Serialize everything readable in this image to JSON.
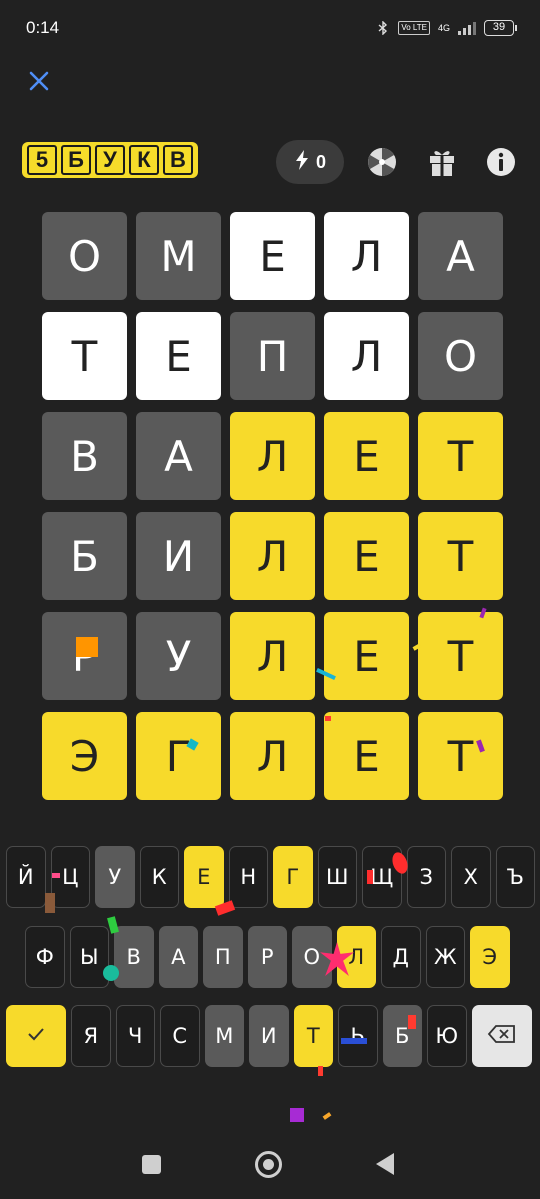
{
  "status": {
    "time": "0:14",
    "network": "4G",
    "volte": "Vo LTE",
    "battery": "39"
  },
  "logo": {
    "letters": [
      "5",
      "Б",
      "У",
      "К",
      "В"
    ]
  },
  "energy": {
    "count": "0"
  },
  "board": {
    "rows": [
      [
        {
          "l": "О",
          "s": "gray"
        },
        {
          "l": "М",
          "s": "gray"
        },
        {
          "l": "Е",
          "s": "white"
        },
        {
          "l": "Л",
          "s": "white"
        },
        {
          "l": "А",
          "s": "gray"
        }
      ],
      [
        {
          "l": "Т",
          "s": "white"
        },
        {
          "l": "Е",
          "s": "white"
        },
        {
          "l": "П",
          "s": "gray"
        },
        {
          "l": "Л",
          "s": "white"
        },
        {
          "l": "О",
          "s": "gray"
        }
      ],
      [
        {
          "l": "В",
          "s": "gray"
        },
        {
          "l": "А",
          "s": "gray"
        },
        {
          "l": "Л",
          "s": "yellow"
        },
        {
          "l": "Е",
          "s": "yellow"
        },
        {
          "l": "Т",
          "s": "yellow"
        }
      ],
      [
        {
          "l": "Б",
          "s": "gray"
        },
        {
          "l": "И",
          "s": "gray"
        },
        {
          "l": "Л",
          "s": "yellow"
        },
        {
          "l": "Е",
          "s": "yellow"
        },
        {
          "l": "Т",
          "s": "yellow"
        }
      ],
      [
        {
          "l": "Р",
          "s": "gray"
        },
        {
          "l": "У",
          "s": "gray"
        },
        {
          "l": "Л",
          "s": "yellow"
        },
        {
          "l": "Е",
          "s": "yellow"
        },
        {
          "l": "Т",
          "s": "yellow"
        }
      ],
      [
        {
          "l": "Э",
          "s": "yellow"
        },
        {
          "l": "Г",
          "s": "yellow"
        },
        {
          "l": "Л",
          "s": "yellow"
        },
        {
          "l": "Е",
          "s": "yellow"
        },
        {
          "l": "Т",
          "s": "yellow"
        }
      ]
    ]
  },
  "keyboard": {
    "row1": [
      {
        "l": "Й",
        "s": "none"
      },
      {
        "l": "Ц",
        "s": "none"
      },
      {
        "l": "У",
        "s": "gray"
      },
      {
        "l": "К",
        "s": "none"
      },
      {
        "l": "Е",
        "s": "yellow"
      },
      {
        "l": "Н",
        "s": "none"
      },
      {
        "l": "Г",
        "s": "yellow"
      },
      {
        "l": "Ш",
        "s": "none"
      },
      {
        "l": "Щ",
        "s": "none"
      },
      {
        "l": "З",
        "s": "none"
      },
      {
        "l": "Х",
        "s": "none"
      },
      {
        "l": "Ъ",
        "s": "none"
      }
    ],
    "row2": [
      {
        "l": "Ф",
        "s": "none"
      },
      {
        "l": "Ы",
        "s": "none"
      },
      {
        "l": "В",
        "s": "gray"
      },
      {
        "l": "А",
        "s": "gray"
      },
      {
        "l": "П",
        "s": "gray"
      },
      {
        "l": "Р",
        "s": "gray"
      },
      {
        "l": "О",
        "s": "gray"
      },
      {
        "l": "Л",
        "s": "yellow"
      },
      {
        "l": "Д",
        "s": "none"
      },
      {
        "l": "Ж",
        "s": "none"
      },
      {
        "l": "Э",
        "s": "yellow"
      }
    ],
    "row3": [
      {
        "l": "Я",
        "s": "none"
      },
      {
        "l": "Ч",
        "s": "none"
      },
      {
        "l": "С",
        "s": "none"
      },
      {
        "l": "М",
        "s": "gray"
      },
      {
        "l": "И",
        "s": "gray"
      },
      {
        "l": "Т",
        "s": "yellow"
      },
      {
        "l": "Ь",
        "s": "none"
      },
      {
        "l": "Б",
        "s": "gray"
      },
      {
        "l": "Ю",
        "s": "none"
      }
    ],
    "enter_icon": "checkmark-icon",
    "backspace_icon": "backspace-icon"
  },
  "colors": {
    "background": "#212121",
    "gray": "#5a5a5a",
    "yellow": "#f7da2b",
    "white": "#ffffff",
    "close": "#4f8ef7"
  }
}
